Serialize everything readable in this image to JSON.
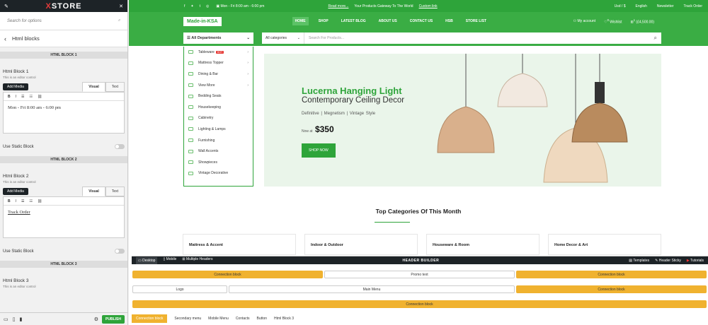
{
  "left_panel": {
    "logo_x": "X",
    "logo_store": "STORE",
    "search_placeholder": "Search for options",
    "title": "Html blocks",
    "blocks": [
      {
        "section": "HTML BLOCK 1",
        "title": "Html Block 1",
        "desc": "This is an editor control",
        "add_media": "Add Media",
        "tab_visual": "Visual",
        "tab_text": "Text",
        "content": "Mon - Fri 8:00 am - 6:00 pm",
        "static_label": "Use Static Block"
      },
      {
        "section": "HTML BLOCK 2",
        "title": "Html Block 2",
        "desc": "This is an editor control",
        "add_media": "Add Media",
        "tab_visual": "Visual",
        "tab_text": "Text",
        "content": "Track Order",
        "static_label": "Use Static Block"
      },
      {
        "section": "HTML BLOCK 3",
        "title": "Html Block 3",
        "desc": "This is an editor control"
      }
    ],
    "publish": "PUBLISH"
  },
  "topbar": {
    "hours": "Mon - Fri 8:00 am - 6:00 pm",
    "readmore": "Read more...",
    "promo": "Your Products Gateway To The World",
    "custom_link": "Custom link",
    "currency": "Usd / $",
    "language": "English",
    "newsletter": "Newsletter",
    "track": "Track Order"
  },
  "header": {
    "brand": "Made-in-KSA",
    "nav": [
      "HOME",
      "SHOP",
      "LATEST BLOG",
      "ABOUT US",
      "CONTACT US",
      "HSB",
      "STORE LIST"
    ],
    "account": "My account",
    "wishlist": "Wishlist",
    "cart": "(£4,500.00)",
    "wishlist_count": "0",
    "cart_count": "1"
  },
  "search": {
    "departments": "All Departments",
    "category": "All categories",
    "placeholder": "Search For Products..."
  },
  "departments": [
    {
      "label": "Tableware",
      "hot": "HOT",
      "arrow": true
    },
    {
      "label": "Mattress Topper",
      "arrow": true
    },
    {
      "label": "Dining & Bar",
      "arrow": true
    },
    {
      "label": "View More",
      "arrow": true
    },
    {
      "label": "Bedding Seats"
    },
    {
      "label": "Housekeeping"
    },
    {
      "label": "Cabinetry"
    },
    {
      "label": "Lighting & Lamps"
    },
    {
      "label": "Furnishing"
    },
    {
      "label": "Wall Accents"
    },
    {
      "label": "Showpieces"
    },
    {
      "label": "Vintage Decorative"
    }
  ],
  "hero": {
    "title": "Lucerna Hanging Light",
    "subtitle": "Contemporary Ceiling Decor",
    "tags": "Definitive  |  Megnetism  |  Vintage Style",
    "now_at": "Now at",
    "price": "$350",
    "button": "SHOP NOW"
  },
  "top_categories": "Top Categories Of This Month",
  "cards": [
    "Mattress & Accent",
    "Indoor & Outdoor",
    "Houseware & Room",
    "Home Decor & Art"
  ],
  "header_builder": {
    "desktop": "Desktop",
    "mobile": "Mobile",
    "multiple": "Multiple Headers",
    "title": "HEADER BUILDER",
    "templates": "Templates",
    "sticky": "Header Sticky",
    "tutorials": "Tutorials",
    "row1": [
      "Connection block",
      "Promo text",
      "Connection block"
    ],
    "row2": [
      "Logo",
      "Main Menu",
      "Connection block"
    ],
    "row3": [
      "Connection block"
    ],
    "items": [
      "Connection block",
      "Secondary menu",
      "Mobile Menu",
      "Contacts",
      "Button",
      "Html Block 3"
    ]
  }
}
